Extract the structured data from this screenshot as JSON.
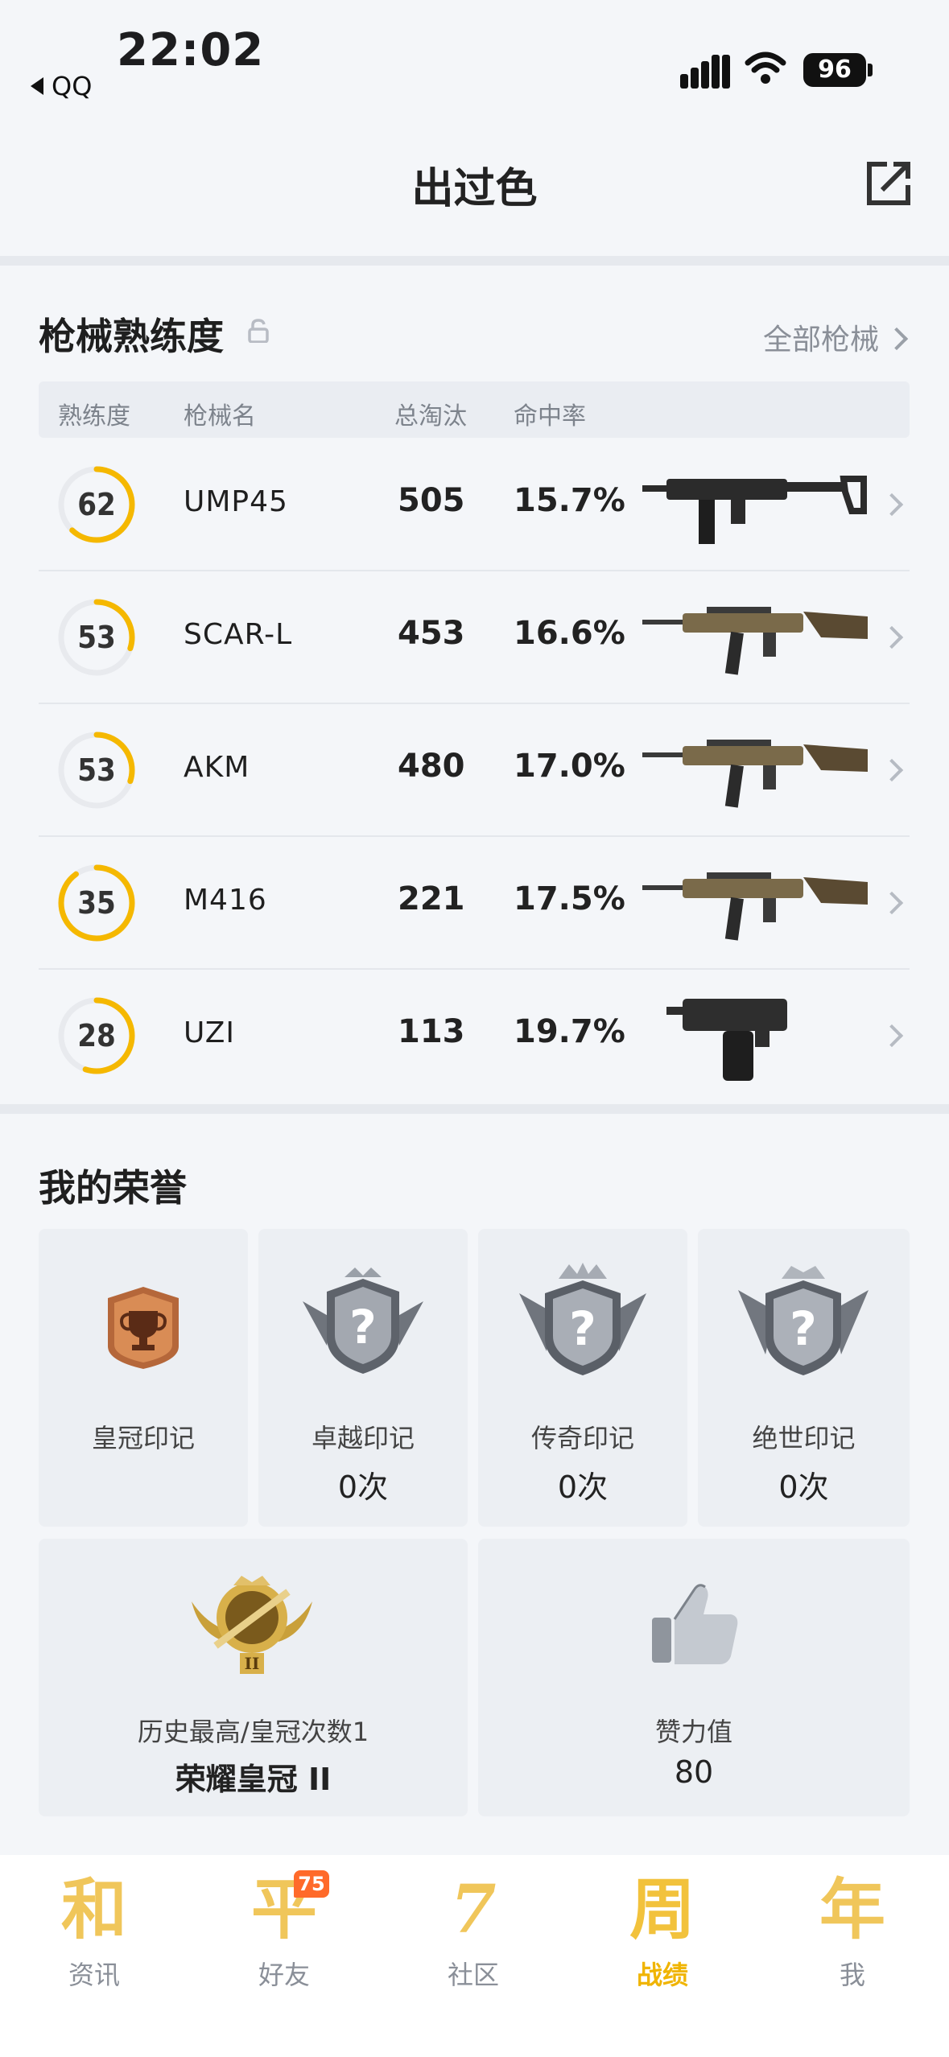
{
  "status_bar": {
    "time": "22:02",
    "back_app": "QQ",
    "battery": "96"
  },
  "header": {
    "title": "出过色"
  },
  "weapons": {
    "title": "枪械熟练度",
    "all_link": "全部枪械",
    "columns": [
      "熟练度",
      "枪械名",
      "总淘汰",
      "命中率"
    ],
    "rows": [
      {
        "mastery": "62",
        "mastery_pct": 0.62,
        "name": "UMP45",
        "kills": "505",
        "hit_rate": "15.7%",
        "gun_icon": "smg-icon"
      },
      {
        "mastery": "53",
        "mastery_pct": 0.3,
        "name": "SCAR-L",
        "kills": "453",
        "hit_rate": "16.6%",
        "gun_icon": "rifle-icon"
      },
      {
        "mastery": "53",
        "mastery_pct": 0.3,
        "name": "AKM",
        "kills": "480",
        "hit_rate": "17.0%",
        "gun_icon": "rifle-icon"
      },
      {
        "mastery": "35",
        "mastery_pct": 0.9,
        "name": "M416",
        "kills": "221",
        "hit_rate": "17.5%",
        "gun_icon": "rifle-icon"
      },
      {
        "mastery": "28",
        "mastery_pct": 0.55,
        "name": "UZI",
        "kills": "113",
        "hit_rate": "19.7%",
        "gun_icon": "machine-pistol-icon"
      }
    ]
  },
  "honors": {
    "title": "我的荣誉",
    "marks": [
      {
        "label": "皇冠印记",
        "count": "",
        "icon": "trophy-badge-icon"
      },
      {
        "label": "卓越印记",
        "count": "0次",
        "icon": "locked-emblem-icon"
      },
      {
        "label": "传奇印记",
        "count": "0次",
        "icon": "locked-emblem-icon"
      },
      {
        "label": "绝世印记",
        "count": "0次",
        "icon": "locked-emblem-icon"
      }
    ],
    "best_rank": {
      "label": "历史最高/皇冠次数1",
      "value": "荣耀皇冠 II"
    },
    "likes": {
      "label": "赞力值",
      "value": "80"
    }
  },
  "tabbar": {
    "items": [
      {
        "glyph": "和",
        "label": "资讯"
      },
      {
        "glyph": "平",
        "label": "好友",
        "badge": "75"
      },
      {
        "glyph": "7",
        "label": "社区"
      },
      {
        "glyph": "周",
        "label": "战绩",
        "active": true
      },
      {
        "glyph": "年",
        "label": "我"
      }
    ]
  },
  "colors": {
    "accent": "#f5b800",
    "ring_track": "#e8eaee",
    "background": "#f4f6f9"
  }
}
